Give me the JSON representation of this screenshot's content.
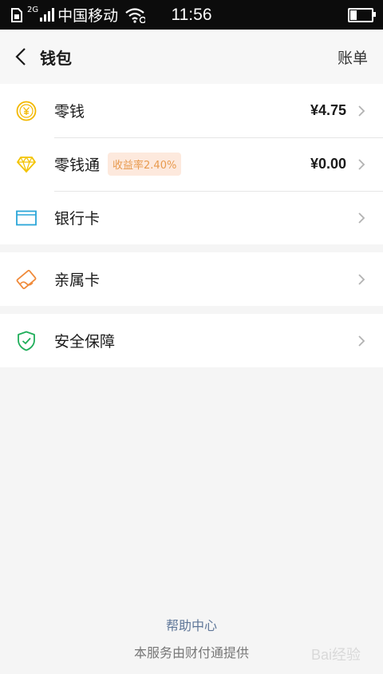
{
  "status_bar": {
    "network_type": "2G",
    "carrier": "中国移动",
    "time": "11:56",
    "battery_level": 0.3
  },
  "nav": {
    "title": "钱包",
    "right_label": "账单"
  },
  "rows": {
    "change": {
      "label": "零钱",
      "value": "¥4.75",
      "icon": "yuan-coin-icon",
      "icon_color": "#f3b800"
    },
    "lct": {
      "label": "零钱通",
      "badge": "收益率2.40%",
      "value": "¥0.00",
      "icon": "diamond-icon",
      "icon_color": "#f3c300"
    },
    "bank": {
      "label": "银行卡",
      "icon": "bank-card-icon",
      "icon_color": "#2aa6d8"
    },
    "family": {
      "label": "亲属卡",
      "icon": "family-card-icon",
      "icon_color": "#f08a3a"
    },
    "security": {
      "label": "安全保障",
      "icon": "shield-icon",
      "icon_color": "#1fae5a"
    }
  },
  "footer": {
    "help": "帮助中心",
    "note": "本服务由财付通提供"
  },
  "watermark": "Bai经验"
}
